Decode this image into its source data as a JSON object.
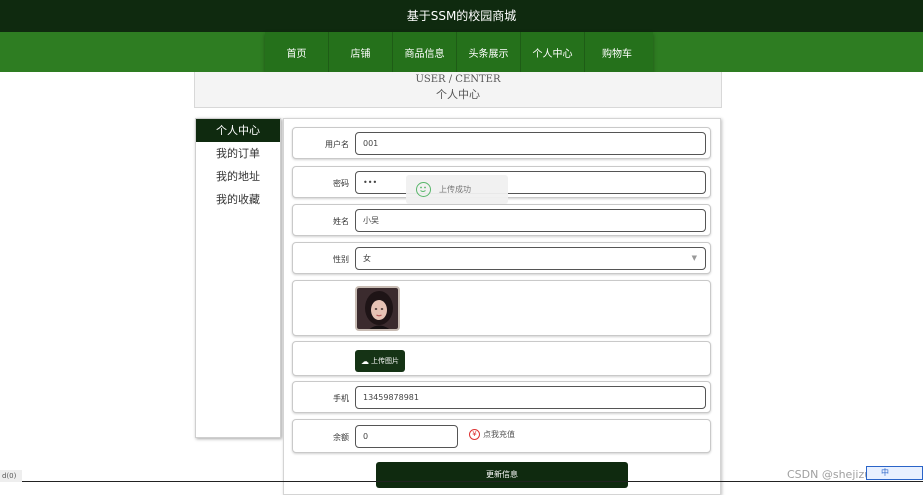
{
  "site": {
    "title": "基于SSM的校园商城"
  },
  "nav": {
    "items": [
      {
        "label": "首页"
      },
      {
        "label": "店铺"
      },
      {
        "label": "商品信息"
      },
      {
        "label": "头条展示"
      },
      {
        "label": "个人中心"
      },
      {
        "label": "购物车"
      }
    ]
  },
  "header": {
    "title_en": "USER / CENTER",
    "title_cn": "个人中心"
  },
  "sidebar": {
    "items": [
      {
        "label": "个人中心",
        "active": true
      },
      {
        "label": "我的订单"
      },
      {
        "label": "我的地址"
      },
      {
        "label": "我的收藏"
      }
    ]
  },
  "form": {
    "username": {
      "label": "用户名",
      "value": "001"
    },
    "password": {
      "label": "密码",
      "value": "•••"
    },
    "name": {
      "label": "姓名",
      "value": "小吴"
    },
    "gender": {
      "label": "性别",
      "value": "女"
    },
    "upload_button": "上传图片",
    "phone": {
      "label": "手机",
      "value": "13459878981"
    },
    "balance": {
      "label": "余额",
      "value": "0",
      "recharge_label": "点我充值"
    },
    "submit": "更新信息"
  },
  "toast": {
    "message": "上传成功"
  },
  "footer": {
    "corner_text": "d(0)",
    "watermark": "CSDN @shejizuopin",
    "ime_badge": "中"
  },
  "colors": {
    "dark_green": "#0f2a0f",
    "nav_green": "#2e7d22",
    "success_icon": "#58b66a"
  }
}
